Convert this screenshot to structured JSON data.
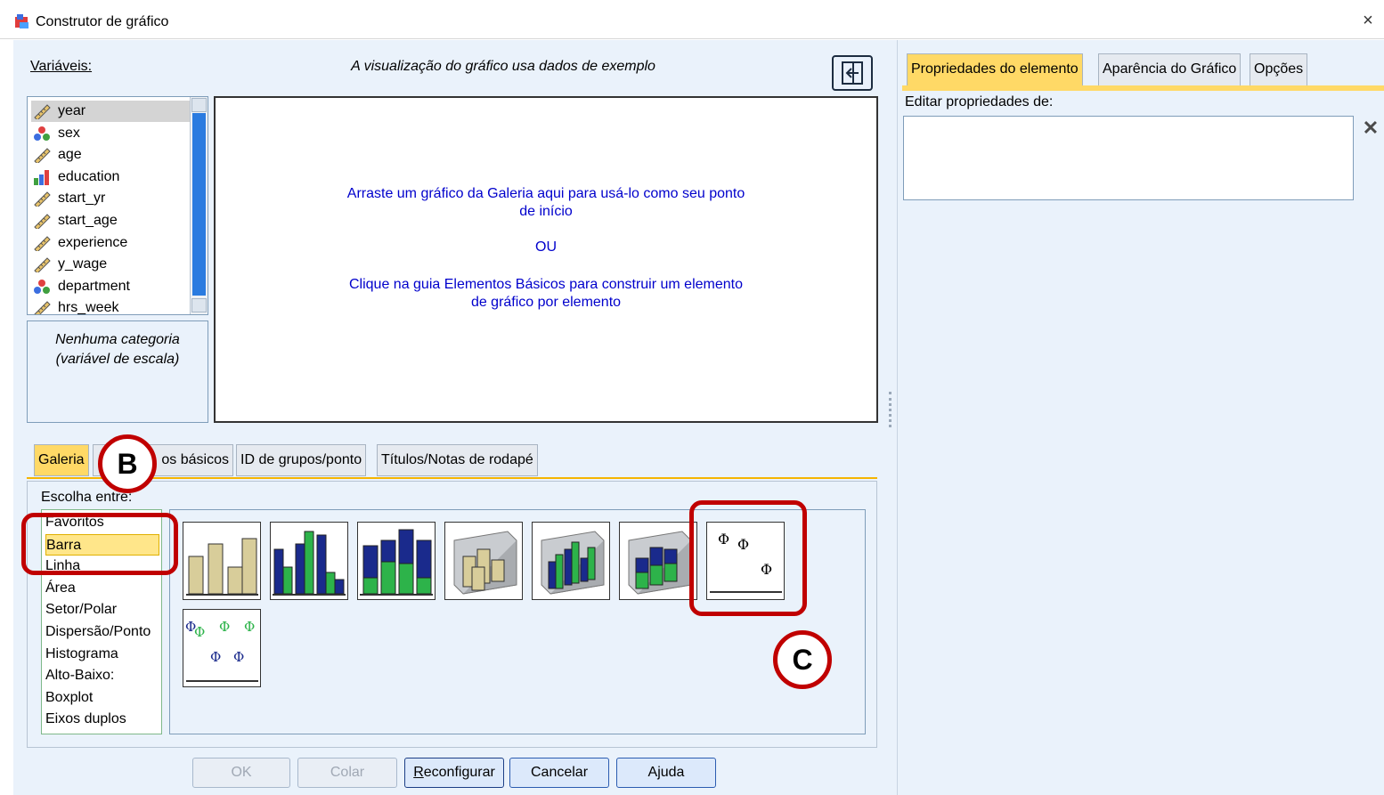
{
  "window": {
    "title": "Construtor de gráfico",
    "close_symbol": "×"
  },
  "left": {
    "variables_label": "Variáveis:",
    "preview_note": "A visualização do gráfico usa dados de exemplo",
    "variables": [
      {
        "name": "year",
        "icon": "ruler-scale-icon",
        "selected": true
      },
      {
        "name": "sex",
        "icon": "nominal-balls-icon"
      },
      {
        "name": "age",
        "icon": "ruler-scale-icon"
      },
      {
        "name": "education",
        "icon": "ordinal-bars-icon"
      },
      {
        "name": "start_yr",
        "icon": "ruler-scale-icon"
      },
      {
        "name": "start_age",
        "icon": "ruler-scale-icon"
      },
      {
        "name": "experience",
        "icon": "ruler-scale-icon"
      },
      {
        "name": "y_wage",
        "icon": "ruler-scale-icon"
      },
      {
        "name": "department",
        "icon": "nominal-balls-icon"
      },
      {
        "name": "hrs_week",
        "icon": "ruler-scale-icon"
      }
    ],
    "category_note_line1": "Nenhuma categoria",
    "category_note_line2": "(variável de escala)",
    "canvas": {
      "line1": "Arraste um gráfico da Galeria aqui para usá-lo como seu ponto",
      "line2": "de início",
      "or": "OU",
      "line3": "Clique na guia Elementos Básicos para construir um elemento",
      "line4": "de gráfico por elemento"
    },
    "tabs": [
      {
        "label": "Galeria",
        "active": true
      },
      {
        "label": "Elementos básicos",
        "visible_text": "os básicos"
      },
      {
        "label": "ID de grupos/ponto"
      },
      {
        "label": "Títulos/Notas de rodapé"
      }
    ],
    "choose_label": "Escolha entre:",
    "chart_types": [
      "Favoritos",
      "Barra",
      "Linha",
      "Área",
      "Setor/Polar",
      "Dispersão/Ponto",
      "Histograma",
      "Alto-Baixo:",
      "Boxplot",
      "Eixos duplos"
    ],
    "selected_type": "Barra",
    "gallery_thumbs": [
      "simple-bar",
      "clustered-bar",
      "stacked-bar",
      "simple-3d-bar",
      "clustered-3d-bar",
      "stacked-3d-bar",
      "simple-error-bar",
      "clustered-error-bar"
    ]
  },
  "buttons": {
    "ok": "OK",
    "paste": "Colar",
    "reset_pre": "",
    "reset_ul": "R",
    "reset_post": "econfigurar",
    "cancel": "Cancelar",
    "help": "Ajuda"
  },
  "right": {
    "tabs": [
      {
        "label": "Propriedades do elemento",
        "active": true
      },
      {
        "label": "Aparência do Gráfico"
      },
      {
        "label": "Opções"
      }
    ],
    "edit_label": "Editar propriedades de:"
  },
  "annotations": {
    "b": "B",
    "c": "C"
  },
  "colors": {
    "accent_tab": "#ffd966",
    "bar_tan": "#d8cd9a",
    "bar_navy": "#1a2a8c",
    "bar_green": "#2db34a",
    "marker": "#c00000",
    "link_text": "#0000cc"
  }
}
